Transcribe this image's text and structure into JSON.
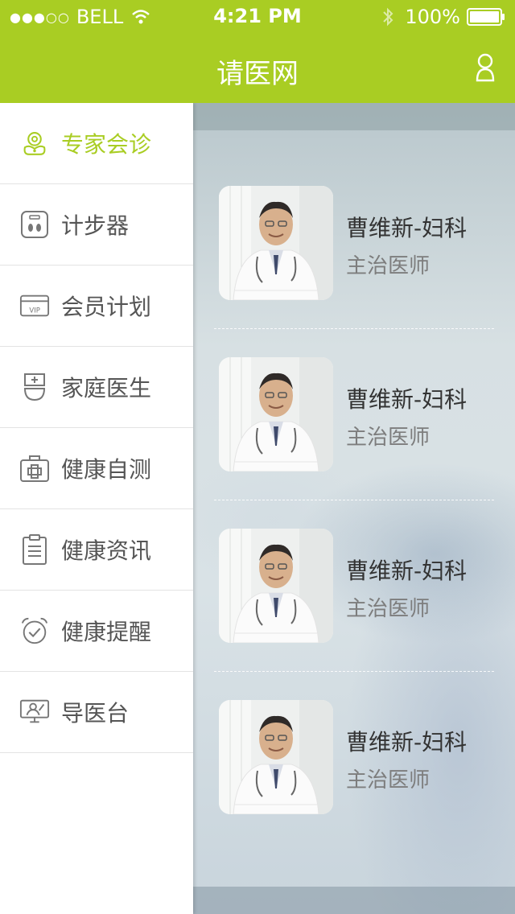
{
  "status_bar": {
    "signal": "●●●○○",
    "carrier": "BELL",
    "time": "4:21 PM",
    "battery": "100%"
  },
  "nav": {
    "title": "请医网",
    "icon": "user-icon"
  },
  "colors": {
    "brand": "#a9cd23",
    "menu_text": "#555555",
    "active_text": "#a9cd23"
  },
  "sidebar": {
    "items": [
      {
        "label": "专家会诊",
        "icon": "expert-consult-icon",
        "active": true
      },
      {
        "label": "计步器",
        "icon": "pedometer-icon",
        "active": false
      },
      {
        "label": "会员计划",
        "icon": "vip-card-icon",
        "active": false
      },
      {
        "label": "家庭医生",
        "icon": "family-doctor-icon",
        "active": false
      },
      {
        "label": "健康自测",
        "icon": "medical-kit-icon",
        "active": false
      },
      {
        "label": "健康资讯",
        "icon": "clipboard-icon",
        "active": false
      },
      {
        "label": "健康提醒",
        "icon": "alarm-clock-icon",
        "active": false
      },
      {
        "label": "导医台",
        "icon": "guide-desk-icon",
        "active": false
      }
    ]
  },
  "doctors": [
    {
      "name": "曹维新-妇科",
      "title": "主治医师"
    },
    {
      "name": "曹维新-妇科",
      "title": "主治医师"
    },
    {
      "name": "曹维新-妇科",
      "title": "主治医师"
    },
    {
      "name": "曹维新-妇科",
      "title": "主治医师"
    }
  ]
}
